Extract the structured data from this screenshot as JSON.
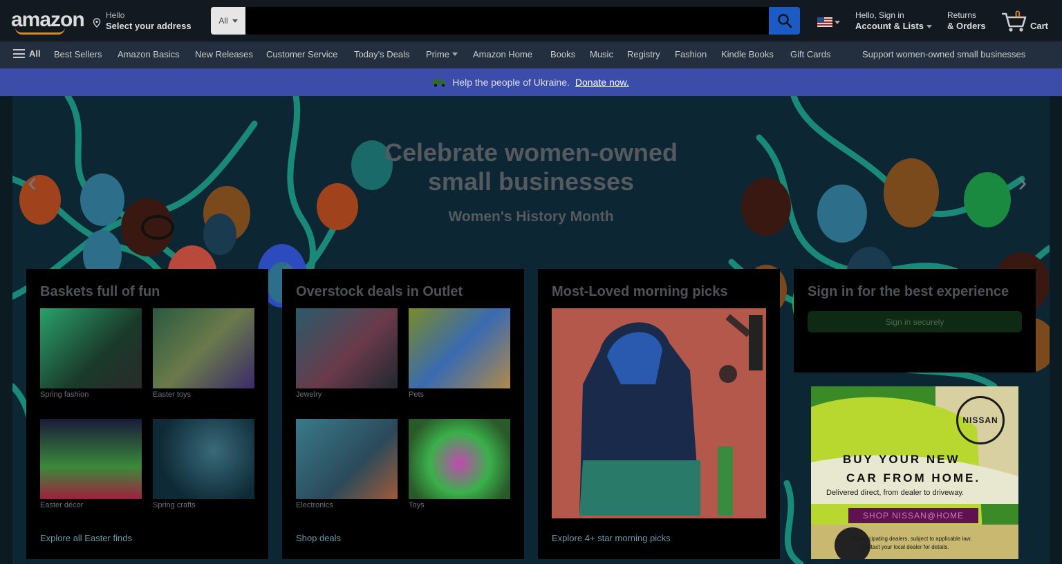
{
  "header": {
    "logo_text": "amazon",
    "location_line1": "Hello",
    "location_line2": "Select your address",
    "search_category": "All",
    "search_placeholder": "",
    "account_line1": "Hello, Sign in",
    "account_line2": "Account & Lists",
    "returns_line1": "Returns",
    "returns_line2": "& Orders",
    "cart_count": "0",
    "cart_label": "Cart"
  },
  "nav": {
    "all_label": "All",
    "items": [
      "Best Sellers",
      "Amazon Basics",
      "New Releases",
      "Customer Service",
      "Today's Deals",
      "Prime",
      "Amazon Home",
      "Books",
      "Music",
      "Registry",
      "Fashion",
      "Kindle Books",
      "Gift Cards"
    ],
    "promo": "Support women-owned small businesses"
  },
  "banner": {
    "text": "Help the people of Ukraine.",
    "link": "Donate now."
  },
  "hero": {
    "title_line1": "Celebrate women-owned",
    "title_line2": "small businesses",
    "subtitle": "Women's History Month"
  },
  "cards": [
    {
      "title": "Baskets full of fun",
      "tiles": [
        "Spring fashion",
        "Easter toys",
        "Easter décor",
        "Spring crafts"
      ],
      "link": "Explore all Easter finds"
    },
    {
      "title": "Overstock deals in Outlet",
      "tiles": [
        "Jewelry",
        "Pets",
        "Electronics",
        "Toys"
      ],
      "link": "Shop deals"
    },
    {
      "title": "Most-Loved morning picks",
      "link": "Explore 4+ star morning picks"
    }
  ],
  "signin": {
    "title": "Sign in for the best experience",
    "button": "Sign in securely"
  },
  "ad": {
    "brand": "NISSAN",
    "headline1": "BUY YOUR NEW",
    "headline2": "CAR FROM HOME.",
    "sub": "Delivered direct, from dealer to driveway.",
    "cta": "SHOP NISSAN@HOME",
    "fine1": "At participating dealers, subject to applicable law.",
    "fine2": "Contact your local dealer for details."
  }
}
